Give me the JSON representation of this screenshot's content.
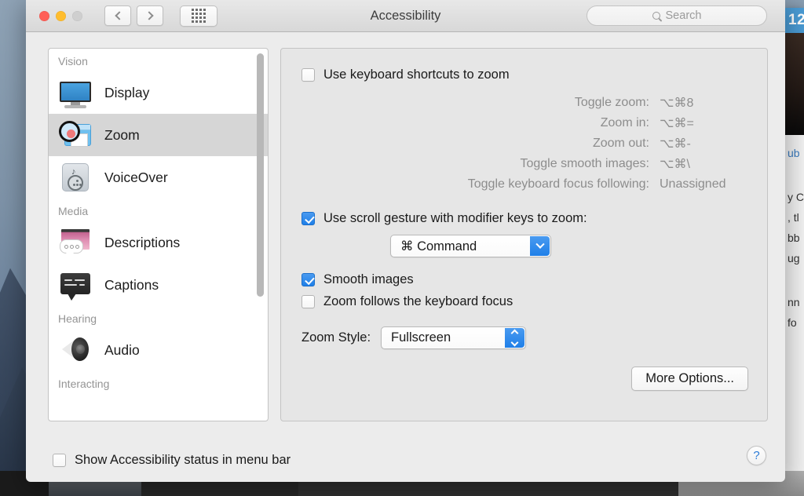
{
  "window": {
    "title": "Accessibility",
    "traffic_lights": [
      "close",
      "minimize",
      "zoom-disabled"
    ],
    "nav": {
      "back": "back-arrow",
      "forward": "forward-arrow",
      "show_all": "grid-icon"
    },
    "search": {
      "placeholder": "Search",
      "icon": "search-icon"
    }
  },
  "sidebar": {
    "groups": [
      {
        "header": "Vision",
        "items": [
          {
            "label": "Display",
            "icon": "display-icon",
            "selected": false
          },
          {
            "label": "Zoom",
            "icon": "zoom-icon",
            "selected": true
          },
          {
            "label": "VoiceOver",
            "icon": "voiceover-icon",
            "selected": false
          }
        ]
      },
      {
        "header": "Media",
        "items": [
          {
            "label": "Descriptions",
            "icon": "descriptions-icon",
            "selected": false
          },
          {
            "label": "Captions",
            "icon": "captions-icon",
            "selected": false
          }
        ]
      },
      {
        "header": "Hearing",
        "items": [
          {
            "label": "Audio",
            "icon": "audio-icon",
            "selected": false
          }
        ]
      },
      {
        "header": "Interacting",
        "items": []
      }
    ]
  },
  "panel": {
    "keyboard_shortcuts": {
      "label": "Use keyboard shortcuts to zoom",
      "checked": false,
      "rows": [
        {
          "name": "Toggle zoom:",
          "key": "⌥⌘8"
        },
        {
          "name": "Zoom in:",
          "key": "⌥⌘="
        },
        {
          "name": "Zoom out:",
          "key": "⌥⌘-"
        },
        {
          "name": "Toggle smooth images:",
          "key": "⌥⌘\\"
        },
        {
          "name": "Toggle keyboard focus following:",
          "key": "Unassigned"
        }
      ]
    },
    "scroll_gesture": {
      "label": "Use scroll gesture with modifier keys to zoom:",
      "checked": true,
      "modifier_value": "⌘ Command"
    },
    "smooth_images": {
      "label": "Smooth images",
      "checked": true
    },
    "follows_focus": {
      "label": "Zoom follows the keyboard focus",
      "checked": false
    },
    "zoom_style": {
      "label": "Zoom Style:",
      "value": "Fullscreen"
    },
    "more_options": "More Options..."
  },
  "bottom": {
    "show_status": {
      "label": "Show Accessibility status in menu bar",
      "checked": false
    },
    "help": "?"
  },
  "background_app": {
    "badge": "12",
    "link_fragment": "ub",
    "text_fragments": [
      "y C",
      ", tl",
      "bb",
      "ug",
      "nn",
      "fo"
    ]
  },
  "colors": {
    "accent": "#1f7fe8",
    "selection": "#d6d6d6",
    "help_blue": "#2b7bd6",
    "badge_blue": "#4a9bd4"
  }
}
